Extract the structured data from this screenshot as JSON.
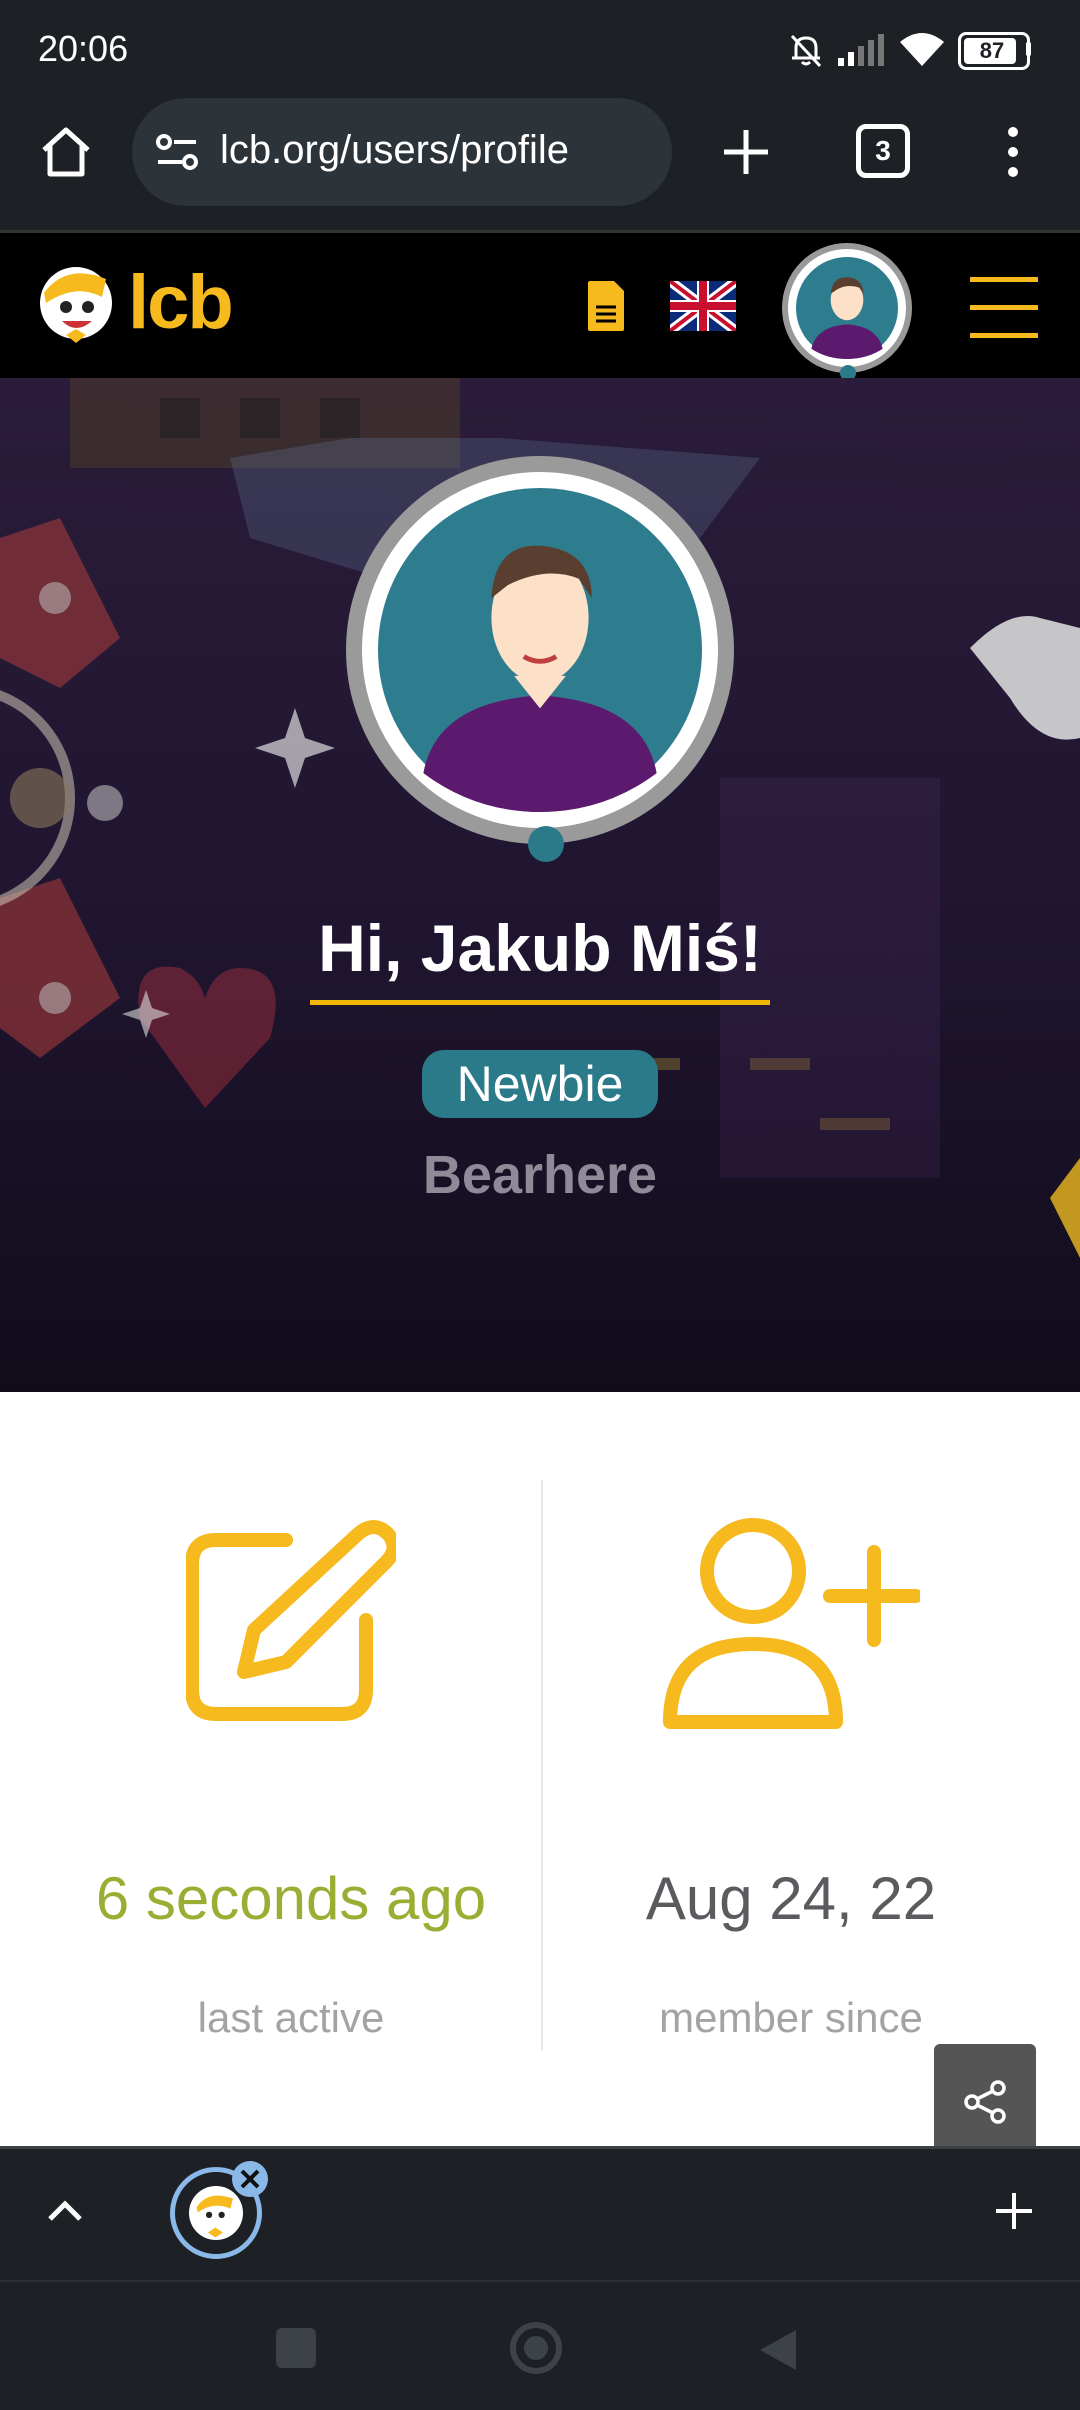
{
  "status_bar": {
    "time": "20:06",
    "battery": "87"
  },
  "browser": {
    "url": "lcb.org/users/profile",
    "tab_count": "3"
  },
  "site": {
    "logo_text": "lcb"
  },
  "profile": {
    "greeting": "Hi, Jakub Miś!",
    "rank": "Newbie",
    "username": "Bearhere"
  },
  "stats": {
    "last_active_value": "6 seconds ago",
    "last_active_label": "last active",
    "member_since_value": "Aug 24, 22",
    "member_since_label": "member since"
  },
  "colors": {
    "brand_yellow": "#f6b91e",
    "accent_green": "#9bae34",
    "badge_teal": "#2a7a8a"
  }
}
